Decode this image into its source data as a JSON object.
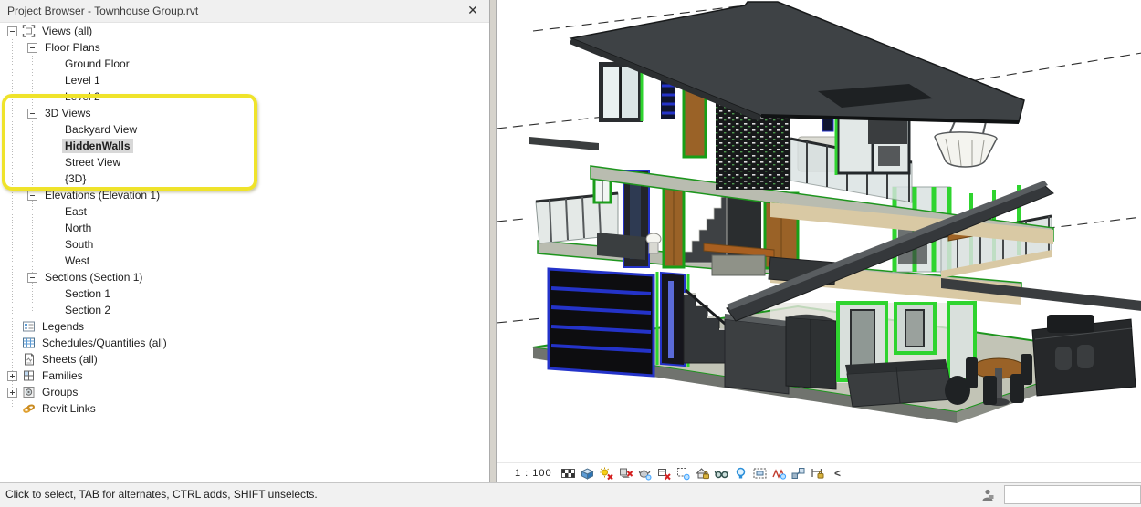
{
  "browser": {
    "title": "Project Browser - Townhouse Group.rvt",
    "close_label": "✕",
    "tree": [
      {
        "label": "Views (all)",
        "level": 0,
        "expand": "minus",
        "icon": "views-all"
      },
      {
        "label": "Floor Plans",
        "level": 1,
        "expand": "minus"
      },
      {
        "label": "Ground Floor",
        "level": 2
      },
      {
        "label": "Level 1",
        "level": 2
      },
      {
        "label": "Level 2",
        "level": 2
      },
      {
        "label": "3D Views",
        "level": 1,
        "expand": "minus",
        "highlighted": true
      },
      {
        "label": "Backyard View",
        "level": 2,
        "highlighted": true
      },
      {
        "label": "HiddenWalls",
        "level": 2,
        "highlighted": true,
        "selected": true,
        "bold": true
      },
      {
        "label": "Street View",
        "level": 2,
        "highlighted": true
      },
      {
        "label": "{3D}",
        "level": 2,
        "highlighted": true
      },
      {
        "label": "Elevations (Elevation 1)",
        "level": 1,
        "expand": "minus"
      },
      {
        "label": "East",
        "level": 2
      },
      {
        "label": "North",
        "level": 2
      },
      {
        "label": "South",
        "level": 2
      },
      {
        "label": "West",
        "level": 2
      },
      {
        "label": "Sections (Section 1)",
        "level": 1,
        "expand": "minus"
      },
      {
        "label": "Section 1",
        "level": 2
      },
      {
        "label": "Section 2",
        "level": 2
      },
      {
        "label": "Legends",
        "level": 0,
        "icon": "legends"
      },
      {
        "label": "Schedules/Quantities (all)",
        "level": 0,
        "icon": "schedules"
      },
      {
        "label": "Sheets (all)",
        "level": 0,
        "icon": "sheets"
      },
      {
        "label": "Families",
        "level": 0,
        "expand": "plus",
        "icon": "families"
      },
      {
        "label": "Groups",
        "level": 0,
        "expand": "plus",
        "icon": "groups"
      },
      {
        "label": "Revit Links",
        "level": 0,
        "icon": "revit-links"
      }
    ]
  },
  "view_control": {
    "scale": "1 : 100",
    "collapse": "<",
    "icons": [
      "detail-level",
      "visual-style",
      "sun-path",
      "shadows",
      "rendering-dialog",
      "crop-view",
      "crop-region",
      "locked-3d-view",
      "temporary-hide-isolate",
      "reveal-hidden-elements",
      "temporary-view-properties",
      "analytical-model",
      "displacement-sets",
      "reveal-constraints"
    ]
  },
  "status": {
    "message": "Click to select, TAB for alternates, CTRL adds, SHIFT unselects.",
    "right_field_value": ""
  },
  "scene": {
    "description": "3D cutaway section view of a three-storey townhouse with hidden walls",
    "view_name": "HiddenWalls"
  },
  "colors": {
    "highlight_yellow": "#EFE32A",
    "selection_gray": "#D8D8D8",
    "edge_green": "#2FD42F",
    "garage_blue": "#2433C9",
    "roof_gray": "#3E4245",
    "wood_brown": "#9A6227",
    "slab_gray": "#B9BCB0",
    "fascia_beige": "#D9C9A4"
  }
}
